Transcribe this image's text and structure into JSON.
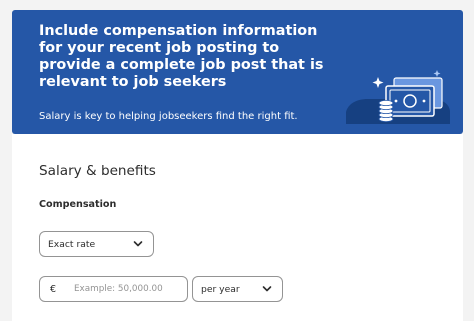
{
  "banner": {
    "title": "Include compensation information for your recent job posting to provide a complete job post that is relevant to job seekers",
    "subtitle": "Salary is key to helping jobseekers find the right fit.",
    "illustration_icon": "money-bills-coins-icon",
    "background_color": "#2557a7"
  },
  "salary": {
    "heading": "Salary & benefits",
    "compensation_label": "Compensation",
    "rate_type": {
      "selected": "Exact rate"
    },
    "amount": {
      "currency_symbol": "€",
      "value": "",
      "placeholder": "Example: 50,000.00"
    },
    "period": {
      "selected": "per year"
    }
  }
}
